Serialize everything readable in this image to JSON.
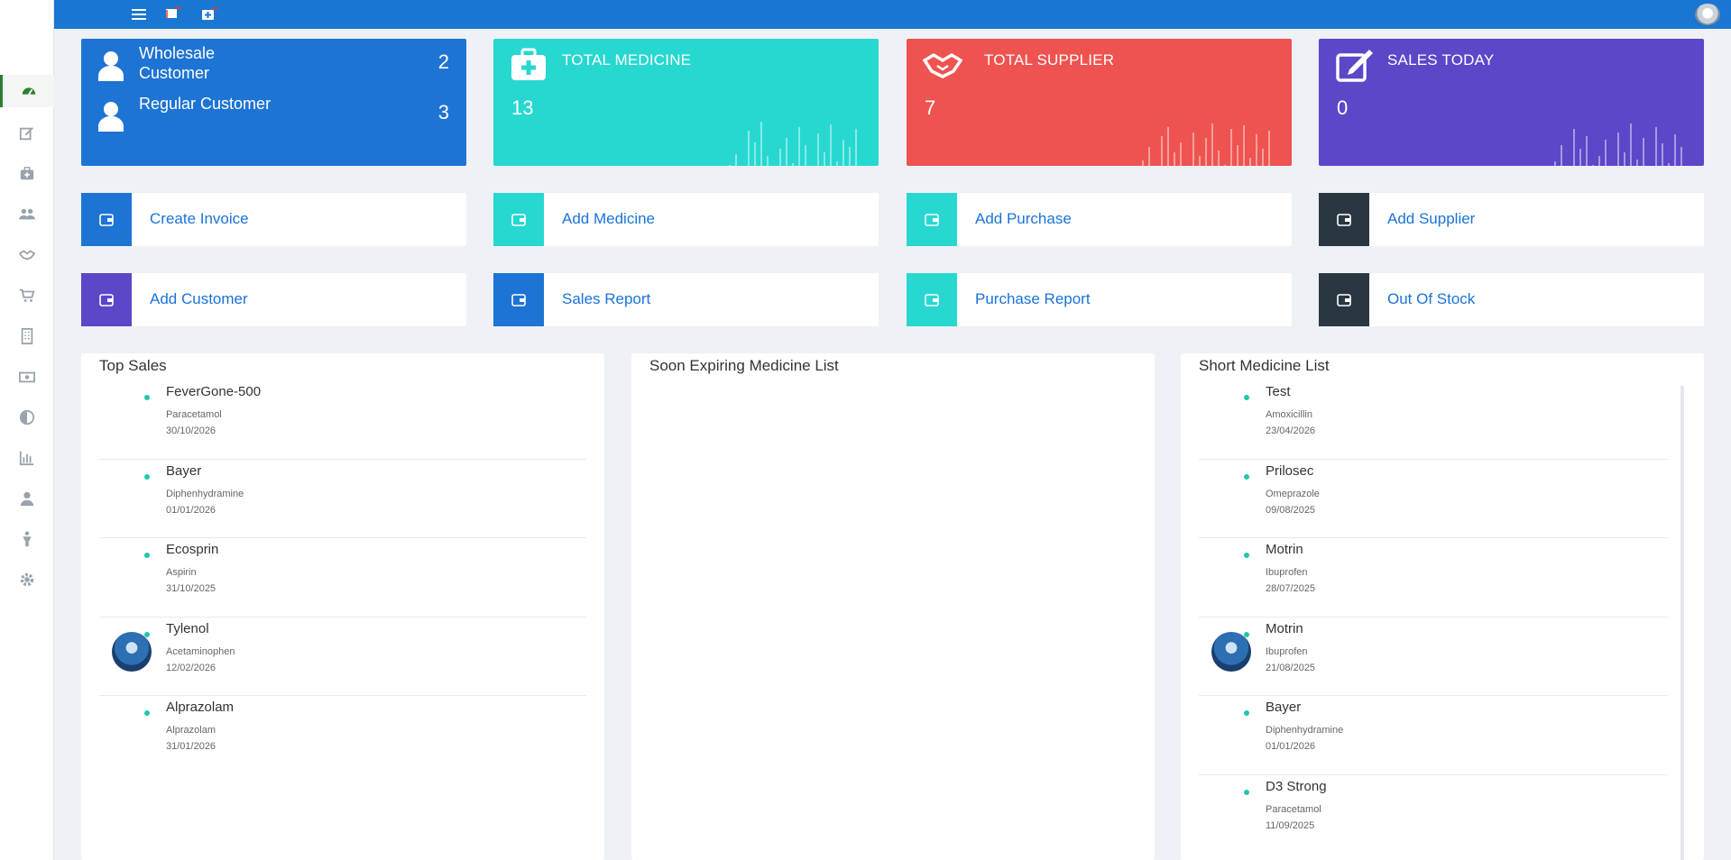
{
  "colors": {
    "topbar": "#1976d2",
    "blue": "#1e74d4",
    "teal": "#27d8d1",
    "red": "#ef5350",
    "purple": "#5c47c9",
    "dark": "#2a3742",
    "link": "#1a73d9"
  },
  "sidebar": {
    "items": [
      {
        "icon": "dashboard-icon",
        "active": true
      },
      {
        "icon": "edit-icon"
      },
      {
        "icon": "medkit-icon"
      },
      {
        "icon": "users-icon"
      },
      {
        "icon": "handshake-icon"
      },
      {
        "icon": "cart-icon"
      },
      {
        "icon": "building-icon"
      },
      {
        "icon": "money-icon"
      },
      {
        "icon": "contrast-icon"
      },
      {
        "icon": "bar-chart-icon"
      },
      {
        "icon": "user-icon"
      },
      {
        "icon": "male-icon"
      },
      {
        "icon": "gear-icon"
      }
    ]
  },
  "topbar": {
    "icons": [
      "menu-icon",
      "flag-icon",
      "medkit-notification-icon"
    ]
  },
  "cards": {
    "customers": {
      "wholesale_label": "Wholesale Customer",
      "wholesale_value": "2",
      "regular_label": "Regular Customer",
      "regular_value": "3"
    },
    "medicine": {
      "title": "TOTAL MEDICINE",
      "value": "13"
    },
    "supplier": {
      "title": "TOTAL SUPPLIER",
      "value": "7"
    },
    "sales": {
      "title": "SALES TODAY",
      "value": "0"
    }
  },
  "quick_actions": [
    {
      "label": "Create Invoice"
    },
    {
      "label": "Add Medicine"
    },
    {
      "label": "Add Purchase"
    },
    {
      "label": "Add Supplier"
    },
    {
      "label": "Add Customer"
    },
    {
      "label": "Sales Report"
    },
    {
      "label": "Purchase Report"
    },
    {
      "label": "Out Of Stock"
    }
  ],
  "top_sales": {
    "title": "Top Sales",
    "items": [
      {
        "name": "FeverGone-500",
        "generic": "Paracetamol",
        "date": "30/10/2026"
      },
      {
        "name": "Bayer",
        "generic": "Diphenhydramine",
        "date": "01/01/2026"
      },
      {
        "name": "Ecosprin",
        "generic": "Aspirin",
        "date": "31/10/2025"
      },
      {
        "name": "Tylenol",
        "generic": "Acetaminophen",
        "date": "12/02/2026"
      },
      {
        "name": "Alprazolam",
        "generic": "Alprazolam",
        "date": "31/01/2026"
      }
    ]
  },
  "expiring": {
    "title": "Soon Expiring Medicine List"
  },
  "short_list": {
    "title": "Short Medicine List",
    "items": [
      {
        "name": "Test",
        "generic": "Amoxicillin",
        "date": "23/04/2026"
      },
      {
        "name": "Prilosec",
        "generic": "Omeprazole",
        "date": "09/08/2025"
      },
      {
        "name": "Motrin",
        "generic": "Ibuprofen",
        "date": "28/07/2025"
      },
      {
        "name": "Motrin",
        "generic": "Ibuprofen",
        "date": "21/08/2025"
      },
      {
        "name": "Bayer",
        "generic": "Diphenhydramine",
        "date": "01/01/2026"
      },
      {
        "name": "D3 Strong",
        "generic": "Paracetamol",
        "date": "11/09/2025"
      }
    ]
  }
}
